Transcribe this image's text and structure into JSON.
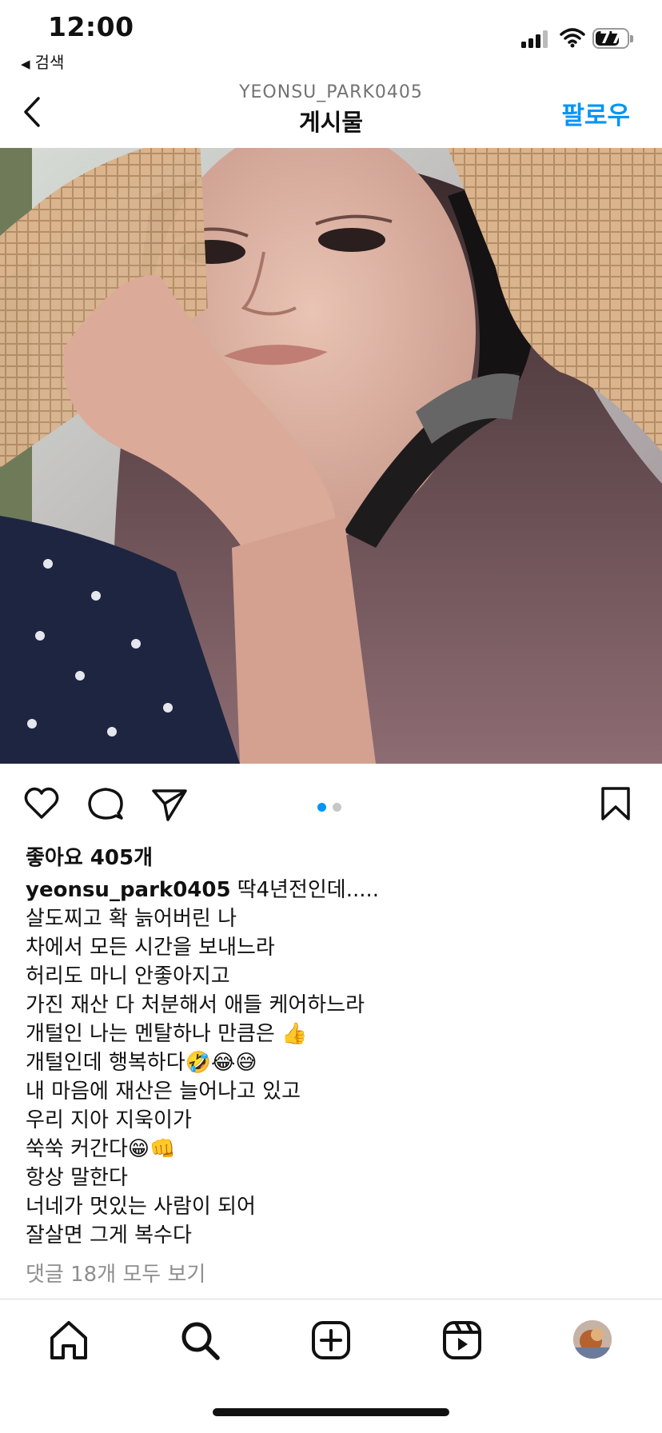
{
  "status_bar": {
    "time": "12:00",
    "back_app_label": "검색",
    "battery_percent": "77",
    "battery_level": 0.77
  },
  "header": {
    "username": "YEONSU_PARK0405",
    "title": "게시물",
    "follow_label": "팔로우"
  },
  "post": {
    "carousel": {
      "total": 2,
      "active": 1,
      "active_color": "#0095f6",
      "inactive_color": "#c7c7c7"
    },
    "likes_text": "좋아요 405개",
    "caption_user": "yeonsu_park0405",
    "caption_lines": [
      "딱4년전인데.....",
      "살도찌고 확 늙어버린 나",
      "차에서 모든 시간을 보내느라",
      "허리도 마니 안좋아지고",
      "가진 재산 다 처분해서 애들 케어하느라",
      "개털인 나는 멘탈하나 만큼은 👍",
      "개털인데 행복하다🤣😂😅",
      "내 마음에 재산은 늘어나고 있고",
      "우리 지아 지욱이가",
      "쑥쑥 커간다😁👊",
      "항상 말한다",
      "너네가 멋있는 사람이 되어",
      "잘살면 그게 복수다"
    ],
    "view_comments": "댓글 18개 모두 보기"
  },
  "icons": {
    "like": "heart-icon",
    "comment": "comment-icon",
    "share": "send-icon",
    "save": "bookmark-icon",
    "home": "home-icon",
    "search": "search-icon",
    "create": "plus-square-icon",
    "reels": "reels-icon",
    "profile": "avatar"
  },
  "colors": {
    "accent": "#0095f6",
    "text": "#111111",
    "muted": "#8e8e8e"
  }
}
